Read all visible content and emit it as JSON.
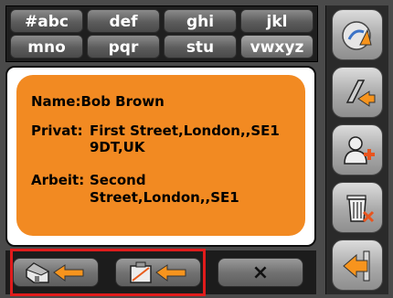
{
  "keyboard": {
    "row1": [
      "#abc",
      "def",
      "ghi",
      "jkl"
    ],
    "row2": [
      "mno",
      "pqr",
      "stu",
      "vwxyz"
    ]
  },
  "contact": {
    "name_label": "Name:",
    "name_value": "Bob Brown",
    "privat_label": "Privat:",
    "privat_line1": "First Street,London,,SE1",
    "privat_line2": "9DT,UK",
    "arbeit_label": "Arbeit:",
    "arbeit_line1": "Second",
    "arbeit_line2": "Street,London,,SE1"
  },
  "bottom_buttons": {
    "close_label": "×"
  },
  "icons": {
    "side": [
      "navigate-to-icon",
      "call-phone-icon",
      "add-contact-icon",
      "delete-trash-icon",
      "back-arrow-icon"
    ],
    "bottom": [
      "home-navigate-icon",
      "work-navigate-icon",
      "close-icon"
    ]
  },
  "colors": {
    "panel_orange": "#f28a22",
    "highlight_red": "#e01b1b",
    "accent_orange": "#f7941d"
  }
}
